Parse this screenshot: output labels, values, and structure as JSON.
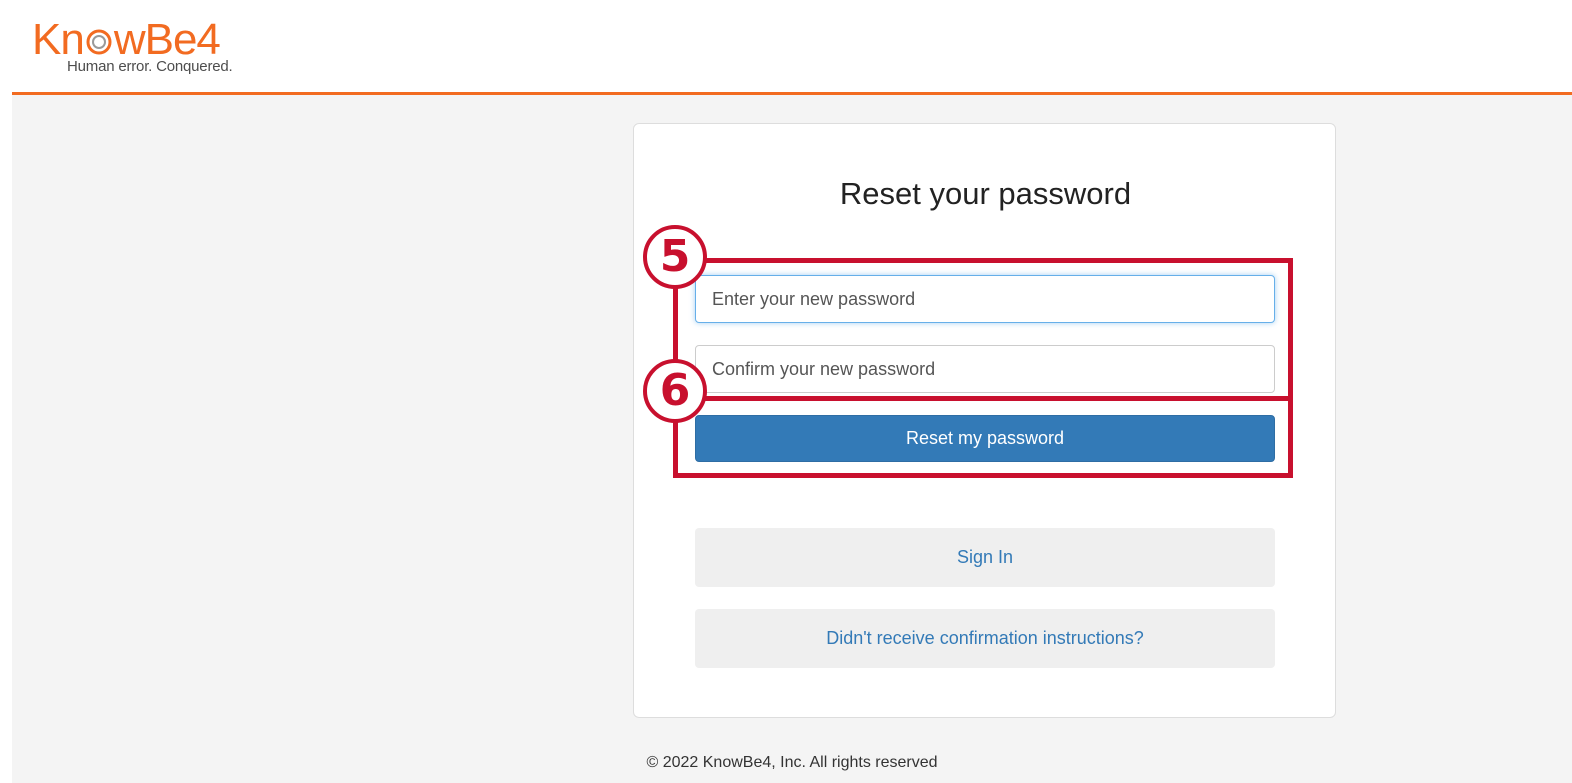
{
  "header": {
    "logo_word_prefix": "Kn",
    "logo_word_suffix": "wBe4",
    "logo_tagline": "Human error. Conquered."
  },
  "card": {
    "title": "Reset your password",
    "new_password_placeholder": "Enter your new password",
    "confirm_password_placeholder": "Confirm your new password",
    "reset_button_label": "Reset my password",
    "sign_in_label": "Sign In",
    "confirmation_link_label": "Didn't receive confirmation instructions?"
  },
  "annotations": {
    "badge_5": "5",
    "badge_6": "6"
  },
  "footer": {
    "copyright": "© 2022 KnowBe4, Inc. All rights reserved"
  },
  "colors": {
    "brand_orange": "#f26b21",
    "primary_button": "#337ab7",
    "annotation_red": "#c8102e"
  }
}
